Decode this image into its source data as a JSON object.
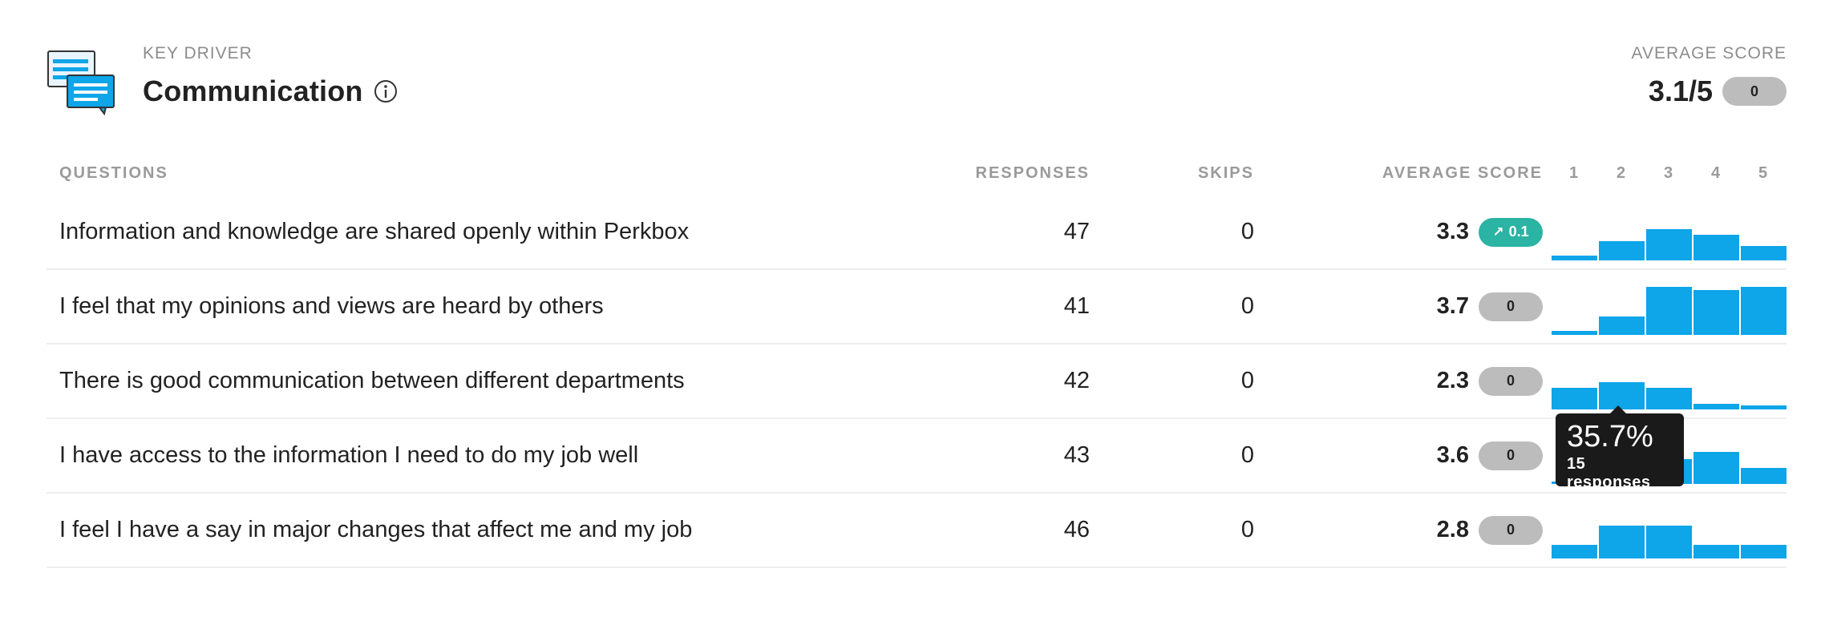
{
  "header": {
    "eyebrow": "KEY DRIVER",
    "title": "Communication",
    "icon": "chat-bubbles-icon",
    "average_label": "AVERAGE SCORE",
    "average_value": "3.1/5",
    "average_change": "0"
  },
  "table": {
    "headers": {
      "questions": "QUESTIONS",
      "responses": "RESPONSES",
      "skips": "SKIPS",
      "average_score": "AVERAGE SCORE",
      "scale": [
        "1",
        "2",
        "3",
        "4",
        "5"
      ]
    },
    "rows": [
      {
        "question": "Information and knowledge are shared openly within Perkbox",
        "responses": "47",
        "skips": "0",
        "score": "3.3",
        "change": "0.1",
        "trend": "up",
        "distribution_percent": [
          6.4,
          25.5,
          40.4,
          34.0,
          19.1
        ]
      },
      {
        "question": "I feel that my opinions and views are heard by others",
        "responses": "41",
        "skips": "0",
        "score": "3.7",
        "change": "0",
        "trend": "none",
        "distribution_percent": [
          4.9,
          24.4,
          63.4,
          58.5,
          63.4
        ]
      },
      {
        "question": "There is good communication between different departments",
        "responses": "42",
        "skips": "0",
        "score": "2.3",
        "change": "0",
        "trend": "none",
        "distribution_percent": [
          28.6,
          35.7,
          28.6,
          7.1,
          4.8
        ]
      },
      {
        "question": "I have access to the information I need to do my job well",
        "responses": "43",
        "skips": "0",
        "score": "3.6",
        "change": "0",
        "trend": "none",
        "distribution_percent": [
          2.3,
          9.3,
          32.6,
          41.9,
          20.9
        ]
      },
      {
        "question": "I feel I have a say in major changes that affect me and my job",
        "responses": "46",
        "skips": "0",
        "score": "2.8",
        "change": "0",
        "trend": "none",
        "distribution_percent": [
          17.4,
          43.5,
          43.5,
          17.4,
          17.4
        ]
      }
    ]
  },
  "tooltip": {
    "percent": "35.7%",
    "responses": "15 responses"
  },
  "colors": {
    "bar": "#0ea5e9",
    "up_badge": "#2bb3a3",
    "neutral_badge": "#bcbcbc"
  }
}
